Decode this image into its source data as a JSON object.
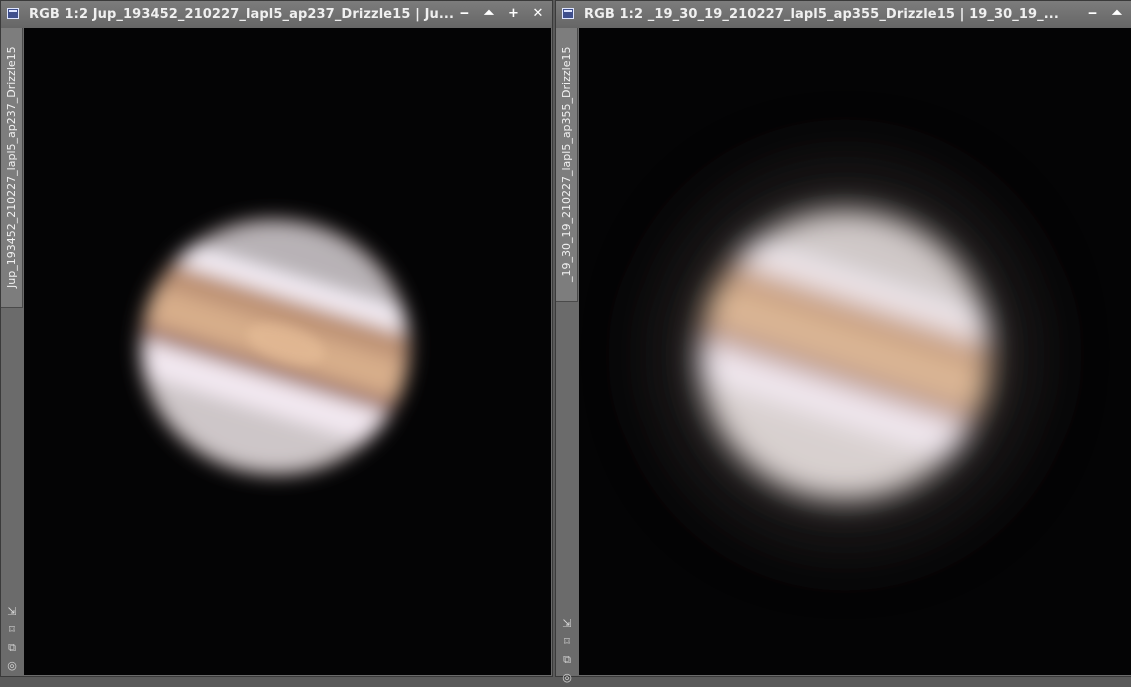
{
  "windows": [
    {
      "title": "RGB 1:2 Jup_193452_210227_lapl5_ap237_Drizzle15 | Ju...",
      "side_tab": "Jup_193452_210227_lapl5_ap237_Drizzle15",
      "icon": "image-window-icon",
      "controls": [
        "minimize",
        "shade",
        "maximize",
        "close"
      ]
    },
    {
      "title": "RGB 1:2 _19_30_19_210227_lapl5_ap355_Drizzle15 | 19_30_19_...",
      "side_tab": "_19_30_19_210227_lapl5_ap355_Drizzle15",
      "icon": "image-window-icon",
      "controls": [
        "minimize",
        "shade"
      ]
    }
  ],
  "controls": {
    "minimize": "‒",
    "shade": "⏶",
    "maximize": "+",
    "close": "✕"
  },
  "tool_icons": {
    "shrink": "⇲",
    "fit": "⌑",
    "clone": "⧉",
    "target": "◎"
  },
  "colors": {
    "titlebar": "#707070",
    "canvas_background": "#040405",
    "planet_belt": "#b58a66",
    "planet_zone": "#f3eef5"
  }
}
